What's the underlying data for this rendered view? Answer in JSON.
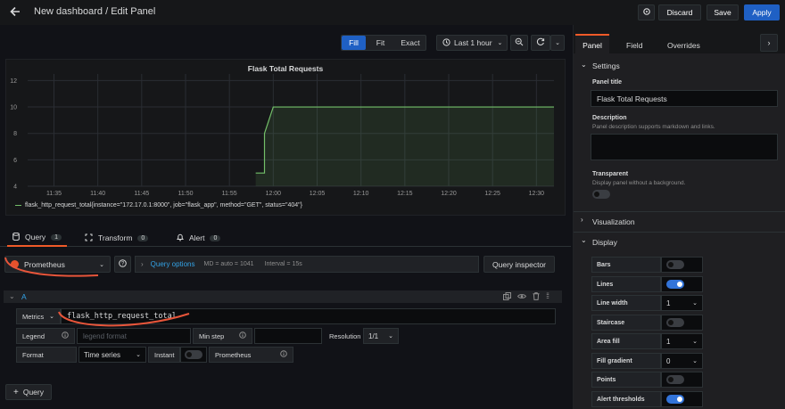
{
  "topbar": {
    "back_icon": "arrow-left-icon",
    "title": "New dashboard / Edit Panel",
    "settings_icon": "gear-icon",
    "discard": "Discard",
    "save": "Save",
    "apply": "Apply"
  },
  "toolbar": {
    "fill": "Fill",
    "fit": "Fit",
    "exact": "Exact",
    "time_range": "Last 1 hour",
    "clock_icon": "clock-icon",
    "zoom_icon": "zoom-out-icon",
    "refresh_icon": "refresh-icon"
  },
  "panel": {
    "title": "Flask Total Requests",
    "legend": "flask_http_request_total{instance=\"172.17.0.1:8000\", job=\"flask_app\", method=\"GET\", status=\"404\"}"
  },
  "chart_data": {
    "type": "area",
    "title": "Flask Total Requests",
    "x": [
      "11:32",
      "11:35",
      "11:40",
      "11:45",
      "11:50",
      "11:55",
      "11:58",
      "11:59",
      "12:00",
      "12:05",
      "12:10",
      "12:15",
      "12:20",
      "12:25",
      "12:30",
      "12:32"
    ],
    "x_ticks": [
      "11:35",
      "11:40",
      "11:45",
      "11:50",
      "11:55",
      "12:00",
      "12:05",
      "12:10",
      "12:15",
      "12:20",
      "12:25",
      "12:30"
    ],
    "series": [
      {
        "name": "flask_http_request_total{instance=\"172.17.0.1:8000\", job=\"flask_app\", method=\"GET\", status=\"404\"}",
        "points": [
          [
            "11:58",
            5
          ],
          [
            "11:59",
            5
          ],
          [
            "11:59",
            8
          ],
          [
            "12:00",
            10
          ],
          [
            "12:32",
            10
          ]
        ]
      }
    ],
    "y_ticks": [
      4,
      6,
      8,
      10,
      12
    ],
    "ylim": [
      4,
      12.5
    ],
    "line_color": "#73bf69",
    "grid": true
  },
  "query_tabs": {
    "query": "Query",
    "query_count": "1",
    "transform": "Transform",
    "transform_count": "0",
    "alert": "Alert",
    "alert_count": "0"
  },
  "datasource": {
    "name": "Prometheus",
    "options_label": "Query options",
    "md": "MD = auto = 1041",
    "interval": "Interval = 15s",
    "inspector": "Query inspector"
  },
  "query_a": {
    "ref": "A",
    "metrics_label": "Metrics",
    "metrics_value": "flask_http_request_total",
    "legend_label": "Legend",
    "legend_placeholder": "legend format",
    "min_step_label": "Min step",
    "resolution_label": "Resolution",
    "resolution_value": "1/1",
    "format_label": "Format",
    "format_value": "Time series",
    "instant_label": "Instant",
    "prometheus_label": "Prometheus"
  },
  "add_query": "Query",
  "side_tabs": {
    "panel": "Panel",
    "field": "Field",
    "overrides": "Overrides"
  },
  "settings": {
    "section": "Settings",
    "panel_title_label": "Panel title",
    "panel_title_value": "Flask Total Requests",
    "description_label": "Description",
    "description_help": "Panel description supports markdown and links.",
    "transparent_label": "Transparent",
    "transparent_help": "Display panel without a background."
  },
  "visualization": {
    "section": "Visualization"
  },
  "display": {
    "section": "Display",
    "rows": [
      {
        "label": "Bars",
        "toggle": false
      },
      {
        "label": "Lines",
        "toggle": true
      },
      {
        "label": "Line width",
        "select": "1"
      },
      {
        "label": "Staircase",
        "toggle": false
      },
      {
        "label": "Area fill",
        "select": "1"
      },
      {
        "label": "Fill gradient",
        "select": "0"
      },
      {
        "label": "Points",
        "toggle": false
      },
      {
        "label": "Alert thresholds",
        "toggle": true
      }
    ]
  },
  "colors": {
    "accent": "#1f60c4",
    "link": "#33a2e5",
    "series": "#73bf69",
    "annotation": "#e8553a"
  }
}
